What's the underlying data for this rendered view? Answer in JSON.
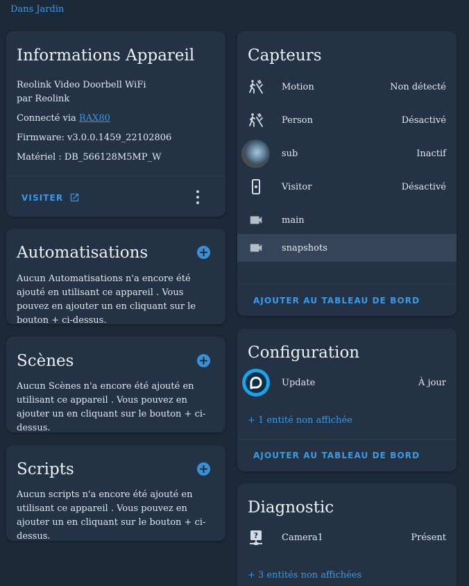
{
  "breadcrumb": "Dans Jardin",
  "device_info": {
    "title": "Informations Appareil",
    "model": "Reolink Video Doorbell WiFi",
    "manufacturer": "par Reolink",
    "connected_prefix": "Connecté via ",
    "connected_link": "RAX80",
    "firmware": "Firmware: v3.0.0.1459_22102806",
    "hardware": "Matériel : DB_566128M5MP_W",
    "visit_label": "VISITER"
  },
  "automations": {
    "title": "Automatisations",
    "empty_text": "Aucun Automatisations n'a encore été ajouté en utilisant ce appareil . Vous pouvez en ajouter un en cliquant sur le bouton + ci-dessus."
  },
  "scenes": {
    "title": "Scènes",
    "empty_text": "Aucun Scènes n'a encore été ajouté en utilisant ce appareil . Vous pouvez en ajouter un en cliquant sur le bouton + ci-dessus."
  },
  "scripts": {
    "title": "Scripts",
    "empty_text": "Aucun scripts n'a encore été ajouté en utilisant ce appareil . Vous pouvez en ajouter un en cliquant sur le bouton + ci-dessus."
  },
  "sensors": {
    "title": "Capteurs",
    "rows": [
      {
        "icon": "motion-sensor-icon",
        "name": "Motion",
        "state": "Non détecté"
      },
      {
        "icon": "motion-sensor-icon",
        "name": "Person",
        "state": "Désactivé"
      },
      {
        "icon": "camera-thumbnail",
        "name": "sub",
        "state": "Inactif"
      },
      {
        "icon": "doorbell-icon",
        "name": "Visitor",
        "state": "Désactivé"
      },
      {
        "icon": "video-icon",
        "name": "main",
        "state": ""
      },
      {
        "icon": "video-icon",
        "name": "snapshots",
        "state": ""
      }
    ],
    "add_to_dashboard": "AJOUTER AU TABLEAU DE BORD"
  },
  "configuration": {
    "title": "Configuration",
    "rows": [
      {
        "icon": "update-icon",
        "name": "Update",
        "state": "À jour"
      }
    ],
    "hidden_link": "+ 1 entité non affichée",
    "add_to_dashboard": "AJOUTER AU TABLEAU DE BORD"
  },
  "diagnostic": {
    "title": "Diagnostic",
    "rows": [
      {
        "icon": "help-network-icon",
        "name": "Camera1",
        "state": "Présent"
      }
    ],
    "hidden_link": "+ 3 entités non affichées"
  },
  "colors": {
    "background": "#1c2938",
    "card": "#233245",
    "accent": "#3e9ae6",
    "highlight_row": "#34455a"
  }
}
